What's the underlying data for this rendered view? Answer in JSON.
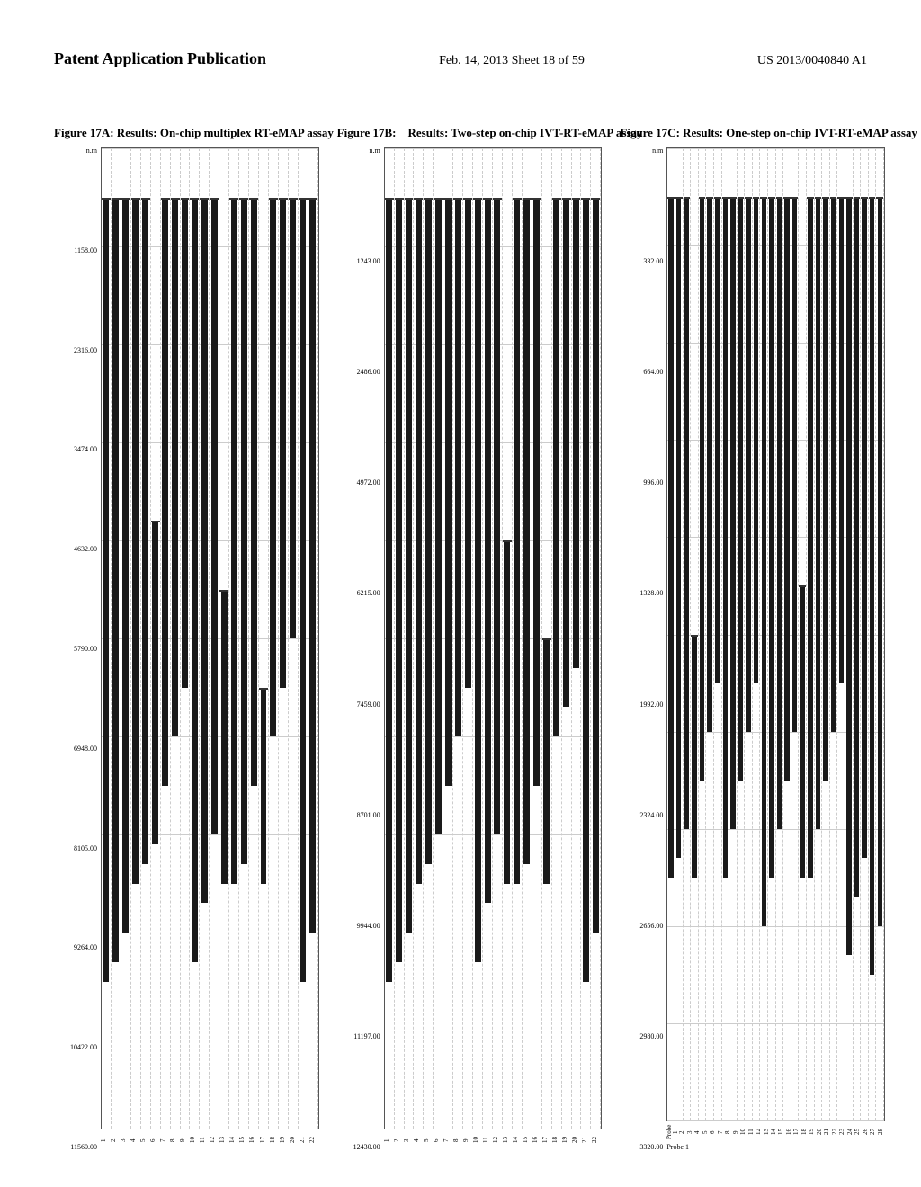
{
  "header": {
    "left": "Patent Application Publication",
    "center": "Feb. 14, 2013   Sheet 18 of 59",
    "right": "US 2013/0040840 A1"
  },
  "figures": {
    "fig_a": {
      "title": "Figure 17A: Results: On-chip multiplex RT-eMAP assay",
      "y_labels": [
        "11560.00",
        "10422.00",
        "9264.00",
        "8105.00",
        "6948.00",
        "5790.00",
        "4632.00",
        "3474.00",
        "2316.00",
        "1158.00",
        "n.m"
      ],
      "num_bars": 22,
      "bars": [
        {
          "col": 1,
          "top_pct": 95,
          "height_pct": 80
        },
        {
          "col": 2,
          "top_pct": 95,
          "height_pct": 78
        },
        {
          "col": 3,
          "top_pct": 95,
          "height_pct": 75
        },
        {
          "col": 4,
          "top_pct": 95,
          "height_pct": 70
        },
        {
          "col": 5,
          "top_pct": 95,
          "height_pct": 68
        },
        {
          "col": 6,
          "top_pct": 62,
          "height_pct": 33
        },
        {
          "col": 7,
          "top_pct": 95,
          "height_pct": 60
        },
        {
          "col": 8,
          "top_pct": 95,
          "height_pct": 55
        },
        {
          "col": 9,
          "top_pct": 95,
          "height_pct": 50
        },
        {
          "col": 10,
          "top_pct": 95,
          "height_pct": 78
        },
        {
          "col": 11,
          "top_pct": 95,
          "height_pct": 72
        },
        {
          "col": 12,
          "top_pct": 95,
          "height_pct": 65
        },
        {
          "col": 13,
          "top_pct": 55,
          "height_pct": 30
        },
        {
          "col": 14,
          "top_pct": 95,
          "height_pct": 70
        },
        {
          "col": 15,
          "top_pct": 95,
          "height_pct": 68
        },
        {
          "col": 16,
          "top_pct": 95,
          "height_pct": 60
        },
        {
          "col": 17,
          "top_pct": 45,
          "height_pct": 20
        },
        {
          "col": 18,
          "top_pct": 95,
          "height_pct": 55
        },
        {
          "col": 19,
          "top_pct": 95,
          "height_pct": 50
        },
        {
          "col": 20,
          "top_pct": 95,
          "height_pct": 45
        },
        {
          "col": 21,
          "top_pct": 95,
          "height_pct": 80
        },
        {
          "col": 22,
          "top_pct": 95,
          "height_pct": 75
        }
      ]
    },
    "fig_b": {
      "title": "Figure 17B:    Results: Two-step on-chip IVT-RT-eMAP assay",
      "y_labels": [
        "12430.00",
        "11197.00",
        "9944.00",
        "8701.00",
        "7459.00",
        "6215.00",
        "4972.00",
        "2486.00",
        "1243.00",
        "n.m"
      ],
      "num_bars": 22,
      "bars": [
        {
          "col": 1,
          "top_pct": 95,
          "height_pct": 80
        },
        {
          "col": 2,
          "top_pct": 95,
          "height_pct": 78
        },
        {
          "col": 3,
          "top_pct": 95,
          "height_pct": 75
        },
        {
          "col": 4,
          "top_pct": 95,
          "height_pct": 70
        },
        {
          "col": 5,
          "top_pct": 95,
          "height_pct": 68
        },
        {
          "col": 6,
          "top_pct": 95,
          "height_pct": 65
        },
        {
          "col": 7,
          "top_pct": 95,
          "height_pct": 60
        },
        {
          "col": 8,
          "top_pct": 95,
          "height_pct": 55
        },
        {
          "col": 9,
          "top_pct": 95,
          "height_pct": 50
        },
        {
          "col": 10,
          "top_pct": 95,
          "height_pct": 78
        },
        {
          "col": 11,
          "top_pct": 95,
          "height_pct": 72
        },
        {
          "col": 12,
          "top_pct": 95,
          "height_pct": 65
        },
        {
          "col": 13,
          "top_pct": 60,
          "height_pct": 35
        },
        {
          "col": 14,
          "top_pct": 95,
          "height_pct": 70
        },
        {
          "col": 15,
          "top_pct": 95,
          "height_pct": 68
        },
        {
          "col": 16,
          "top_pct": 95,
          "height_pct": 60
        },
        {
          "col": 17,
          "top_pct": 50,
          "height_pct": 25
        },
        {
          "col": 18,
          "top_pct": 95,
          "height_pct": 55
        },
        {
          "col": 19,
          "top_pct": 95,
          "height_pct": 52
        },
        {
          "col": 20,
          "top_pct": 95,
          "height_pct": 48
        },
        {
          "col": 21,
          "top_pct": 95,
          "height_pct": 80
        },
        {
          "col": 22,
          "top_pct": 95,
          "height_pct": 75
        }
      ]
    },
    "fig_c": {
      "title": "Figure 17C: Results: One-step on-chip IVT-RT-eMAP assay",
      "y_labels": [
        "3320.00",
        "2980.00",
        "2656.00",
        "2324.00",
        "1992.00",
        "1328.00",
        "996.00",
        "664.00",
        "332.00",
        "n.m"
      ],
      "probe_labels": [
        "Probe 1",
        "2",
        "3",
        "4",
        "5",
        "6",
        "7",
        "8",
        "9",
        "10",
        "11",
        "12",
        "13",
        "14",
        "15",
        "16",
        "17",
        "18",
        "19",
        "20",
        "21",
        "22",
        "23",
        "24",
        "25",
        "26",
        "27",
        "28"
      ],
      "num_bars": 28,
      "bars": [
        {
          "col": 1,
          "top_pct": 95,
          "height_pct": 70
        },
        {
          "col": 2,
          "top_pct": 95,
          "height_pct": 68
        },
        {
          "col": 3,
          "top_pct": 95,
          "height_pct": 65
        },
        {
          "col": 4,
          "top_pct": 50,
          "height_pct": 25
        },
        {
          "col": 5,
          "top_pct": 95,
          "height_pct": 60
        },
        {
          "col": 6,
          "top_pct": 95,
          "height_pct": 55
        },
        {
          "col": 7,
          "top_pct": 95,
          "height_pct": 50
        },
        {
          "col": 8,
          "top_pct": 95,
          "height_pct": 70
        },
        {
          "col": 9,
          "top_pct": 95,
          "height_pct": 65
        },
        {
          "col": 10,
          "top_pct": 95,
          "height_pct": 60
        },
        {
          "col": 11,
          "top_pct": 95,
          "height_pct": 55
        },
        {
          "col": 12,
          "top_pct": 95,
          "height_pct": 50
        },
        {
          "col": 13,
          "top_pct": 95,
          "height_pct": 75
        },
        {
          "col": 14,
          "top_pct": 95,
          "height_pct": 70
        },
        {
          "col": 15,
          "top_pct": 95,
          "height_pct": 65
        },
        {
          "col": 16,
          "top_pct": 95,
          "height_pct": 60
        },
        {
          "col": 17,
          "top_pct": 95,
          "height_pct": 55
        },
        {
          "col": 18,
          "top_pct": 55,
          "height_pct": 30
        },
        {
          "col": 19,
          "top_pct": 95,
          "height_pct": 70
        },
        {
          "col": 20,
          "top_pct": 95,
          "height_pct": 65
        },
        {
          "col": 21,
          "top_pct": 95,
          "height_pct": 60
        },
        {
          "col": 22,
          "top_pct": 95,
          "height_pct": 55
        },
        {
          "col": 23,
          "top_pct": 95,
          "height_pct": 50
        },
        {
          "col": 24,
          "top_pct": 95,
          "height_pct": 78
        },
        {
          "col": 25,
          "top_pct": 95,
          "height_pct": 72
        },
        {
          "col": 26,
          "top_pct": 95,
          "height_pct": 68
        },
        {
          "col": 27,
          "top_pct": 95,
          "height_pct": 80
        },
        {
          "col": 28,
          "top_pct": 95,
          "height_pct": 75
        }
      ]
    }
  },
  "colors": {
    "background": "#ffffff",
    "text": "#000000",
    "bar": "#1a1a1a",
    "grid": "#bbbbbb",
    "border": "#444444"
  }
}
